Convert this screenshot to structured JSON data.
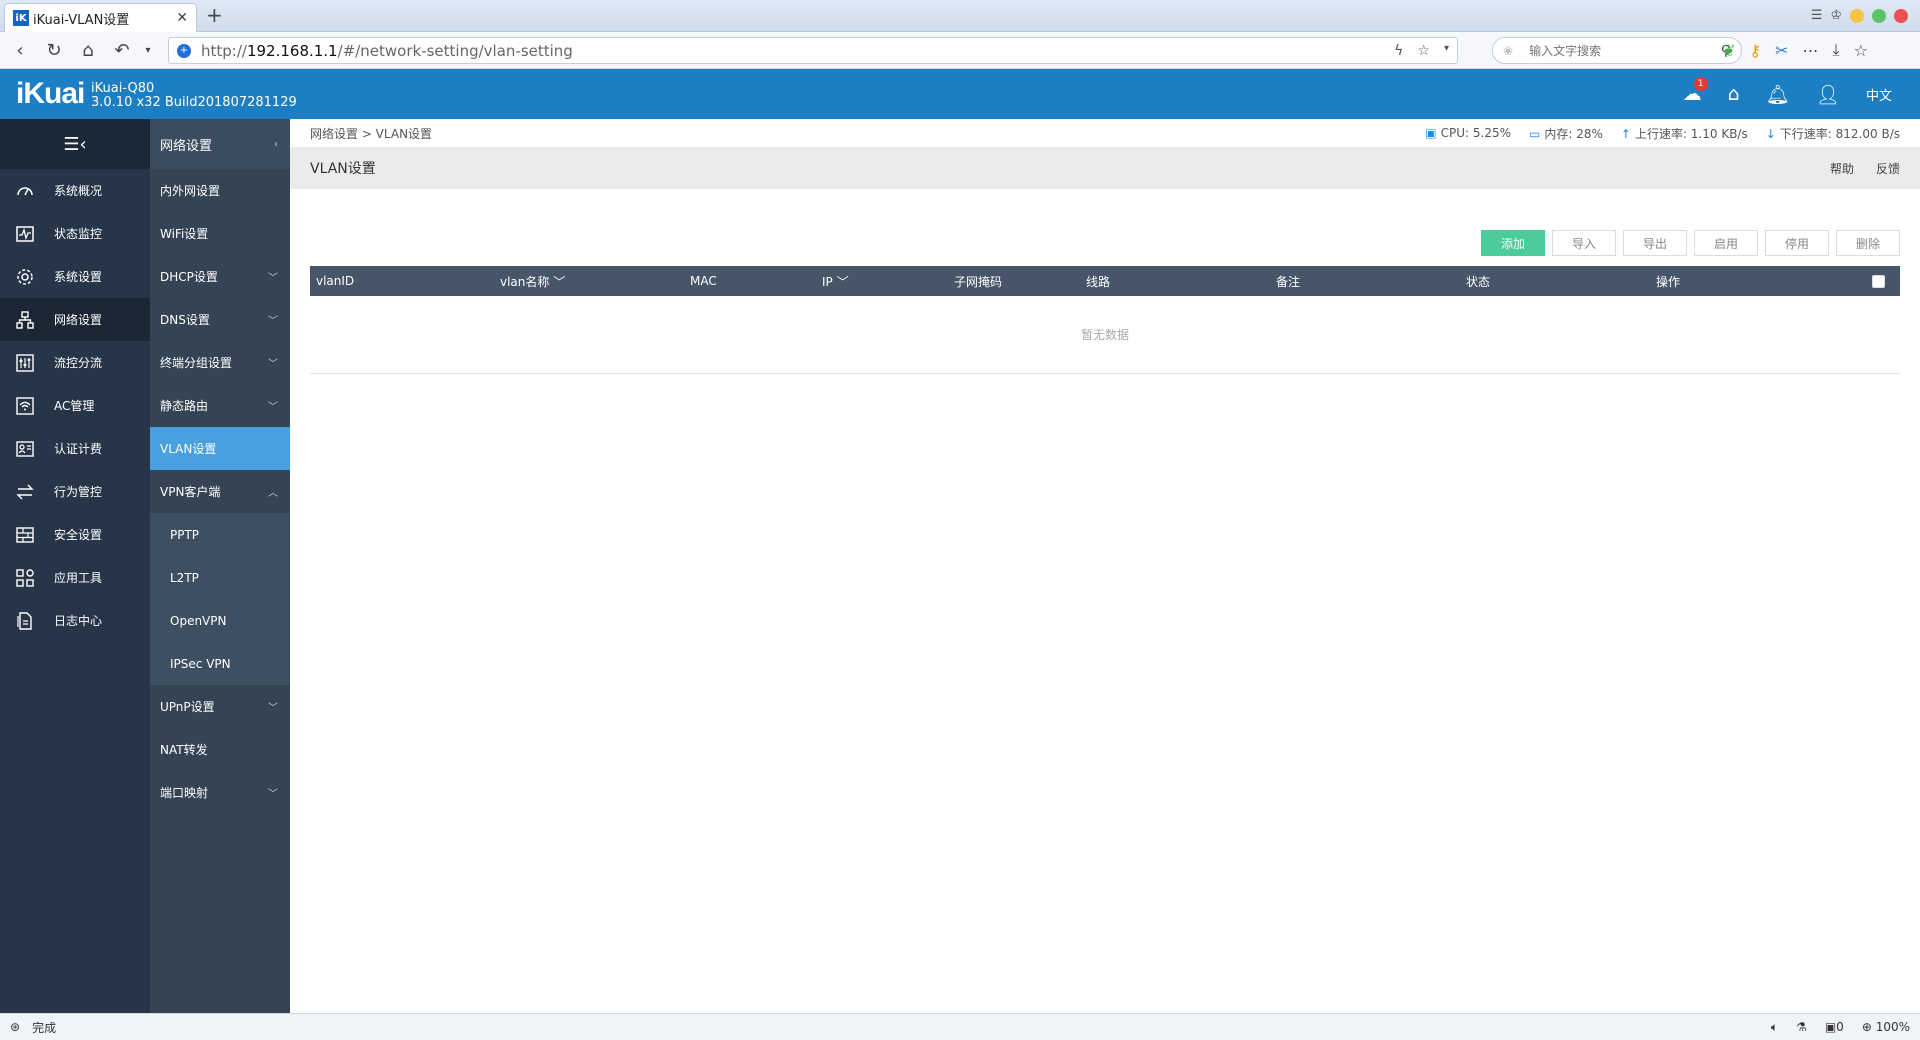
{
  "browser": {
    "tab_title": "iKuai-VLAN设置",
    "url_prefix": "http://",
    "url_host": "192.168.1.1",
    "url_path": "/#/network-setting/vlan-setting",
    "search_placeholder": "输入文字搜索",
    "status_text": "完成",
    "counter": "0",
    "zoom": "100%"
  },
  "header": {
    "logo": "iKuai",
    "model": "iKuai-Q80",
    "build": "3.0.10 x32 Build201807281129",
    "notification_count": "1",
    "lang": "中文"
  },
  "sidebar": {
    "items": [
      {
        "label": "系统概况"
      },
      {
        "label": "状态监控"
      },
      {
        "label": "系统设置"
      },
      {
        "label": "网络设置"
      },
      {
        "label": "流控分流"
      },
      {
        "label": "AC管理"
      },
      {
        "label": "认证计费"
      },
      {
        "label": "行为管控"
      },
      {
        "label": "安全设置"
      },
      {
        "label": "应用工具"
      },
      {
        "label": "日志中心"
      }
    ]
  },
  "subnav": {
    "title": "网络设置",
    "items": [
      {
        "label": "内外网设置"
      },
      {
        "label": "WiFi设置"
      },
      {
        "label": "DHCP设置"
      },
      {
        "label": "DNS设置"
      },
      {
        "label": "终端分组设置"
      },
      {
        "label": "静态路由"
      },
      {
        "label": "VLAN设置"
      },
      {
        "label": "VPN客户端"
      },
      {
        "label": "PPTP"
      },
      {
        "label": "L2TP"
      },
      {
        "label": "OpenVPN"
      },
      {
        "label": "IPSec VPN"
      },
      {
        "label": "UPnP设置"
      },
      {
        "label": "NAT转发"
      },
      {
        "label": "端口映射"
      }
    ]
  },
  "main": {
    "breadcrumb": "网络设置 > VLAN设置",
    "stats": {
      "cpu": "CPU: 5.25%",
      "mem": "内存: 28%",
      "up": "上行速率: 1.10 KB/s",
      "down": "下行速率: 812.00 B/s"
    },
    "title": "VLAN设置",
    "help": "帮助",
    "feedback": "反馈",
    "buttons": {
      "add": "添加",
      "import": "导入",
      "export": "导出",
      "enable": "启用",
      "disable": "停用",
      "delete": "删除"
    },
    "columns": [
      "vlanID",
      "vlan名称",
      "MAC",
      "IP",
      "子网掩码",
      "线路",
      "备注",
      "状态",
      "操作"
    ],
    "empty_text": "暂无数据"
  },
  "colors": {
    "header_blue": "#1c7fc4",
    "sidebar_dark": "#263648",
    "subnav": "#344455",
    "active_blue": "#4a9fe0",
    "add_green": "#4ccc9a"
  }
}
